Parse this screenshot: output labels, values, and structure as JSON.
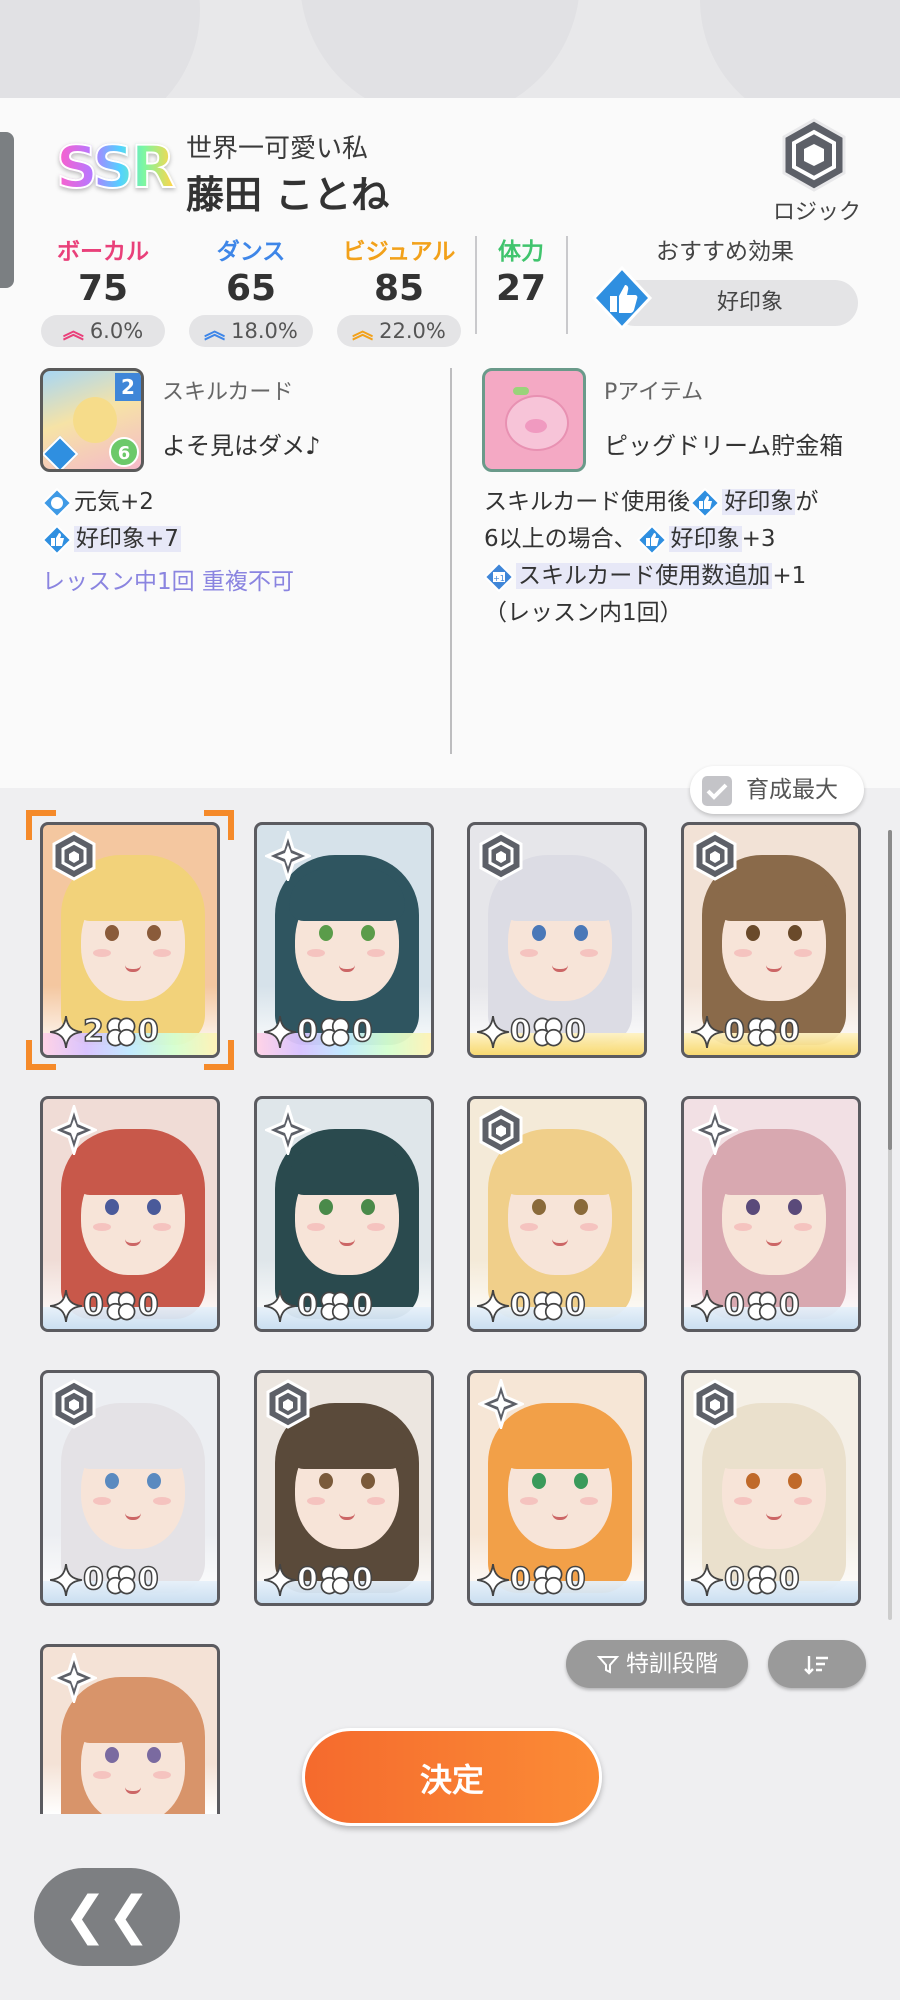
{
  "card": {
    "rarity": "SSR",
    "subtitle": "世界一可愛い私",
    "name": "藤田 ことね",
    "plan_label": "ロジック"
  },
  "stats": [
    {
      "label": "ボーカル",
      "value": "75",
      "bonus": "6.0%",
      "color": "#e9407a"
    },
    {
      "label": "ダンス",
      "value": "65",
      "bonus": "18.0%",
      "color": "#3e86e8"
    },
    {
      "label": "ビジュアル",
      "value": "85",
      "bonus": "22.0%",
      "color": "#f2a11a"
    }
  ],
  "stamina": {
    "label": "体力",
    "value": "27"
  },
  "recommended": {
    "label": "おすすめ効果",
    "value": "好印象"
  },
  "skill_card": {
    "title": "スキルカード",
    "name": "よそ見はダメ♪",
    "effects": [
      {
        "icon": "genki-icon",
        "text": "元気+2"
      },
      {
        "icon": "good-impression-icon",
        "text": "好印象+7"
      }
    ],
    "note": "レッスン中1回 重複不可"
  },
  "p_item": {
    "title": "Pアイテム",
    "name": "ピッグドリーム貯金箱",
    "line1_a": "スキルカード使用後",
    "line1_b": "好印象",
    "line1_c": "が",
    "line2_a": "6以上の場合、",
    "line2_b": "好印象",
    "line2_c": "+3",
    "line3_a": "スキルカード使用数追加",
    "line3_b": "+1",
    "line4": "（レッスン内1回）"
  },
  "toggle": {
    "label": "育成最大",
    "checked": true
  },
  "cards": [
    {
      "plan": "logic",
      "stars": "2",
      "clover": "0",
      "hair": "#f2d27a",
      "eye": "#8a5b3a",
      "bg": "#f4c7a0",
      "frame": "rainbow",
      "selected": true
    },
    {
      "plan": "sense",
      "stars": "0",
      "clover": "0",
      "hair": "#2f5560",
      "eye": "#5a9c4a",
      "bg": "#d6e2ea",
      "frame": "rainbow",
      "selected": false
    },
    {
      "plan": "logic",
      "stars": "0",
      "clover": "0",
      "hair": "#dcdce4",
      "eye": "#4a78b8",
      "bg": "#e6e6ea",
      "frame": "gold",
      "selected": false
    },
    {
      "plan": "logic",
      "stars": "0",
      "clover": "0",
      "hair": "#8a6a4a",
      "eye": "#6a4a2a",
      "bg": "#f2e2d6",
      "frame": "gold",
      "selected": false
    },
    {
      "plan": "sense",
      "stars": "0",
      "clover": "0",
      "hair": "#c8584a",
      "eye": "#4a5a9a",
      "bg": "#f0dcd6",
      "frame": "blue",
      "selected": false
    },
    {
      "plan": "sense",
      "stars": "0",
      "clover": "0",
      "hair": "#2a4a4e",
      "eye": "#4a8a4a",
      "bg": "#dfe6ea",
      "frame": "blue",
      "selected": false
    },
    {
      "plan": "logic",
      "stars": "0",
      "clover": "0",
      "hair": "#f0cf8a",
      "eye": "#8a6a3a",
      "bg": "#f4ead8",
      "frame": "blue",
      "selected": false
    },
    {
      "plan": "sense",
      "stars": "0",
      "clover": "0",
      "hair": "#d8a8b0",
      "eye": "#5a4a7a",
      "bg": "#f2e0e4",
      "frame": "blue",
      "selected": false
    },
    {
      "plan": "logic",
      "stars": "0",
      "clover": "0",
      "hair": "#e4e2e6",
      "eye": "#5a8ac0",
      "bg": "#eceef2",
      "frame": "blue",
      "selected": false
    },
    {
      "plan": "logic",
      "stars": "0",
      "clover": "0",
      "hair": "#5a4a3a",
      "eye": "#7a5a3a",
      "bg": "#ece6e0",
      "frame": "blue",
      "selected": false
    },
    {
      "plan": "sense",
      "stars": "0",
      "clover": "0",
      "hair": "#f2a048",
      "eye": "#3a9a5a",
      "bg": "#f6e6d6",
      "frame": "blue",
      "selected": false
    },
    {
      "plan": "logic",
      "stars": "0",
      "clover": "0",
      "hair": "#eae0cc",
      "eye": "#c06a2a",
      "bg": "#f4efe6",
      "frame": "blue",
      "selected": false
    },
    {
      "plan": "sense",
      "stars": "",
      "clover": "",
      "hair": "#d8946a",
      "eye": "#7a6aa0",
      "bg": "#f4e2d6",
      "frame": "blue",
      "selected": false
    }
  ],
  "filter_chip": "特訓段階",
  "decide_button": "決定",
  "back_button": "❮❮"
}
